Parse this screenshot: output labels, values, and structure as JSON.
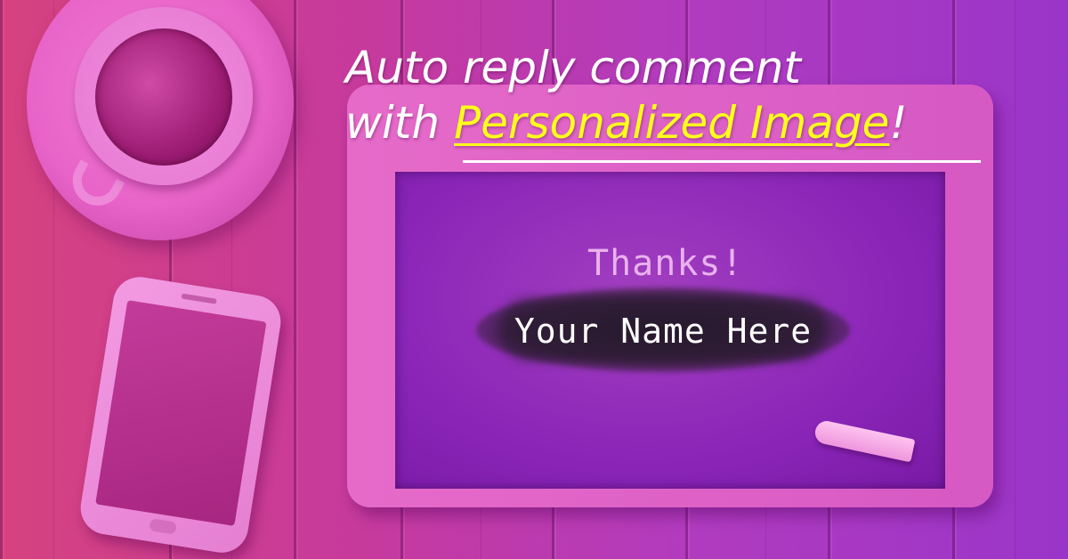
{
  "headline": {
    "line1": "Auto reply comment",
    "line2_prefix": "with ",
    "line2_highlight": "Personalized Image",
    "line2_suffix": "!"
  },
  "slate": {
    "greeting": "Thanks!",
    "name_placeholder": "Your Name Here"
  },
  "colors": {
    "highlight_text": "#ffff1a",
    "headline_text": "#ffffff",
    "board": "#8a25b8",
    "frame": "#e066c8"
  },
  "icons": [
    "coffee-cup-icon",
    "smartphone-icon",
    "chalk-icon"
  ]
}
